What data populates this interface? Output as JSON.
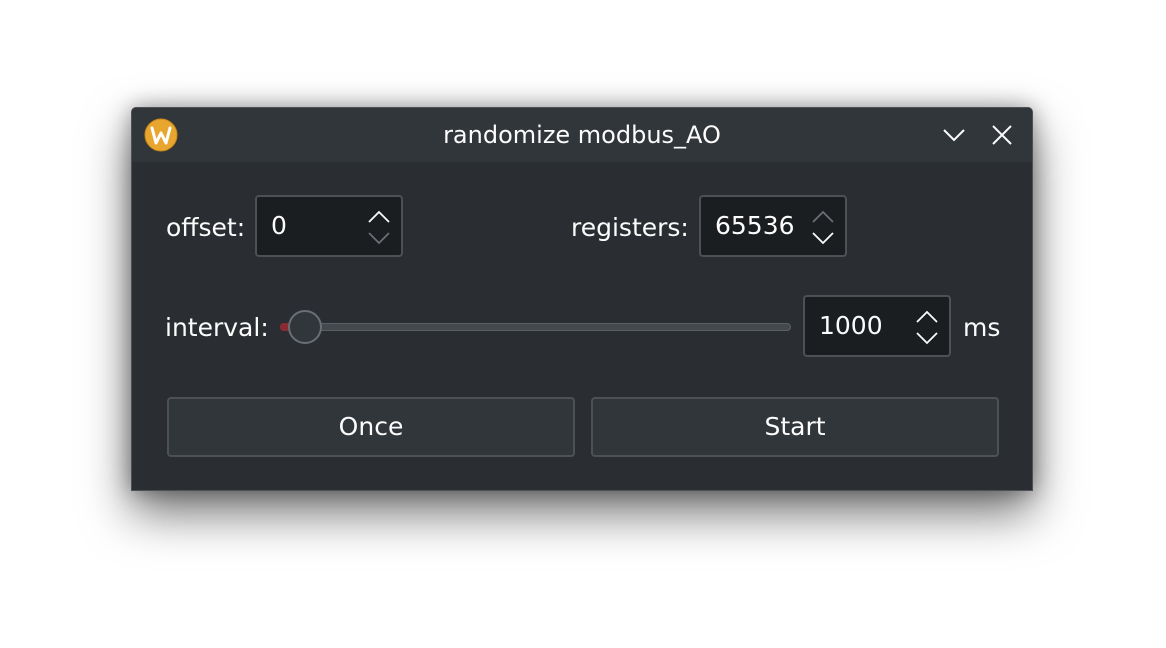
{
  "window": {
    "title": "randomize modbus_AO",
    "icons": {
      "app": "app-logo-icon",
      "minimize": "chevron-down-icon",
      "close": "close-icon"
    }
  },
  "form": {
    "offset": {
      "label": "offset:",
      "value": "0"
    },
    "registers": {
      "label": "registers:",
      "value": "65536"
    },
    "interval": {
      "label": "interval:",
      "slider_level": 0,
      "value": "1000",
      "unit": "ms"
    }
  },
  "buttons": {
    "once": "Once",
    "start": "Start"
  },
  "colors": {
    "accent": "#8a2a33",
    "window_bg": "#2a2e32",
    "titlebar_bg": "#31363b",
    "app_icon": "#e8a62f"
  }
}
